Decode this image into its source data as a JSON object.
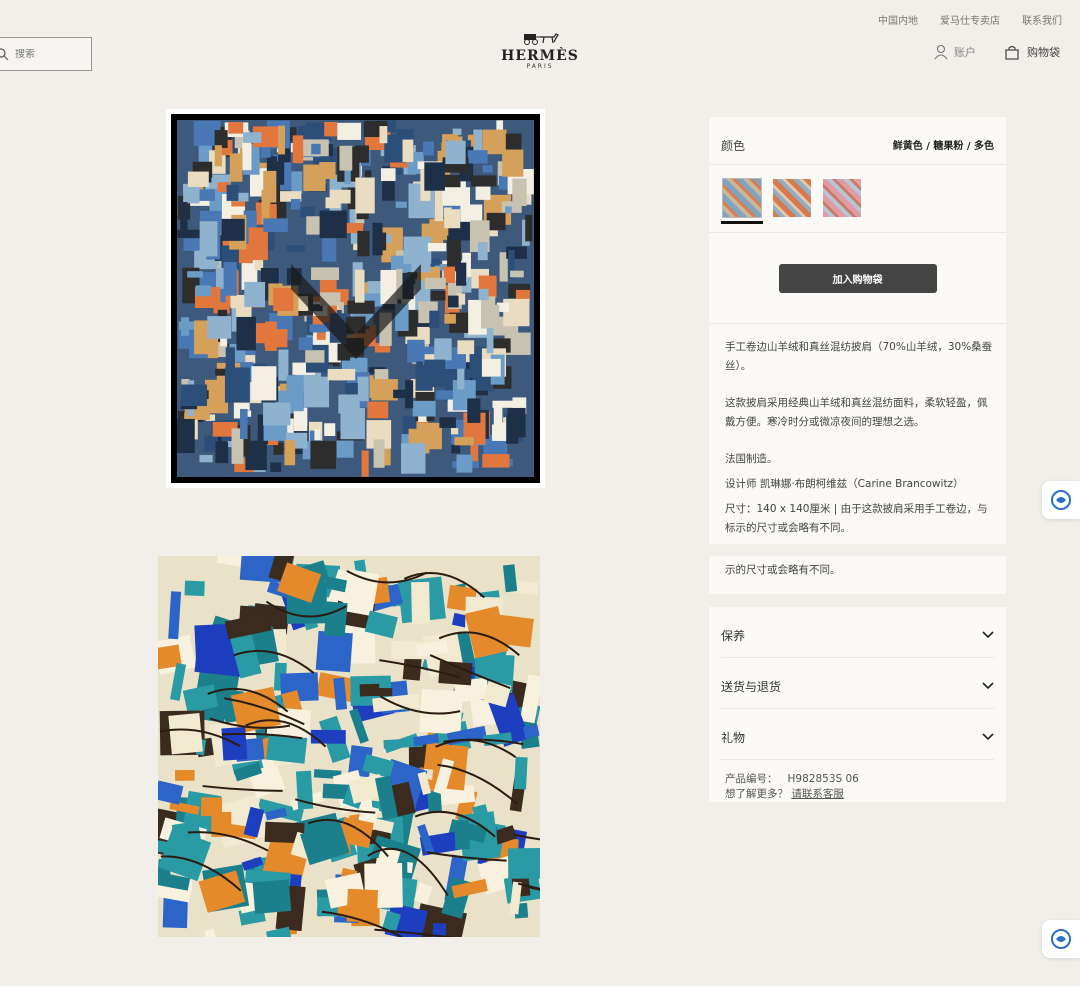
{
  "header": {
    "links": [
      "中国内地",
      "爱马仕专卖店",
      "联系我们"
    ],
    "search": {
      "placeholder": "搜索"
    },
    "logo": {
      "brand": "HERMÈS",
      "sub": "PARIS"
    },
    "account_label": "账户",
    "bag_label": "购物袋"
  },
  "product": {
    "color_label": "颜色",
    "color_value": "鲜黄色 / 糖果粉 / 多色",
    "swatches": [
      {
        "name": "swatch-blue",
        "colors": [
          "#7fa3c2",
          "#c8b89a",
          "#e07b4c"
        ]
      },
      {
        "name": "swatch-orange",
        "colors": [
          "#d97a4e",
          "#8fb0c9",
          "#e6c6a8"
        ]
      },
      {
        "name": "swatch-pink",
        "colors": [
          "#e29aa4",
          "#b7c6d6",
          "#c97b6a"
        ]
      }
    ],
    "add_to_bag": "加入购物袋",
    "description": {
      "line1": "手工卷边山羊绒和真丝混纺披肩（70%山羊绒，30%桑蚕丝）。",
      "line2": "这款披肩采用经典山羊绒和真丝混纺面料，柔软轻盈，佩戴方便。寒冷时分或微凉夜间的理想之选。",
      "line3": "法国制造。",
      "designer": "设计师 凯琳娜·布朗柯维兹（Carine Brancowitz）",
      "size": "尺寸：140 x 140厘米 | 由于这款披肩采用手工卷边，与标示的尺寸或会略有不同。"
    },
    "extra_line": "示的尺寸或会略有不同。",
    "accordion": [
      "保养",
      "送货与退货",
      "礼物"
    ],
    "sku_label": "产品编号：",
    "sku_value": "H982853S 06",
    "more_label": "想了解更多？",
    "contact_link": "请联系客服"
  },
  "colors": {
    "background": "#f2efea",
    "panel": "#faf9f6",
    "button": "#444444"
  }
}
